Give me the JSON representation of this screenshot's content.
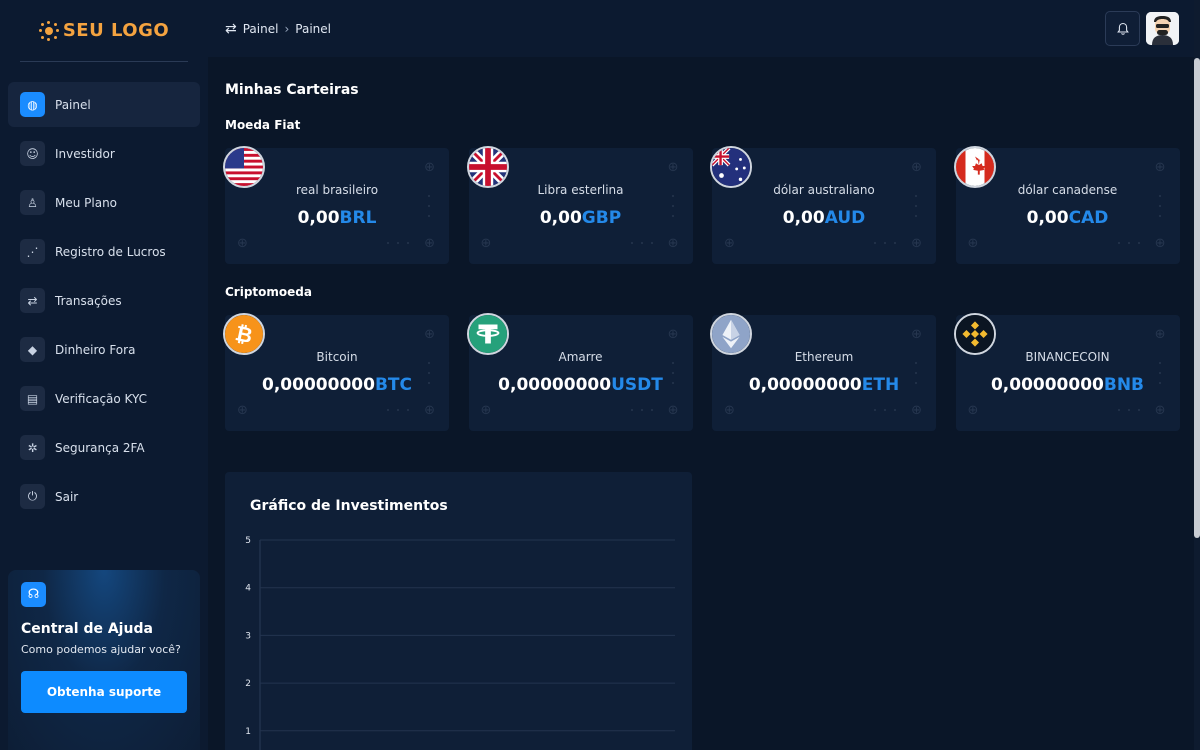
{
  "logo": {
    "text": "SEU LOGO",
    "color": "#f4a340"
  },
  "sidebar": {
    "items": [
      {
        "label": "Painel",
        "icon": "dashboard-icon",
        "glyph": "◍",
        "active": true
      },
      {
        "label": "Investidor",
        "icon": "user-icon",
        "glyph": "☺",
        "active": false
      },
      {
        "label": "Meu Plano",
        "icon": "plan-icon",
        "glyph": "♙",
        "active": false
      },
      {
        "label": "Registro de Lucros",
        "icon": "profit-chart-icon",
        "glyph": "⋰",
        "active": false
      },
      {
        "label": "Transações",
        "icon": "transfer-icon",
        "glyph": "⇄",
        "active": false
      },
      {
        "label": "Dinheiro Fora",
        "icon": "withdraw-icon",
        "glyph": "◆",
        "active": false
      },
      {
        "label": "Verificação KYC",
        "icon": "id-card-icon",
        "glyph": "▤",
        "active": false
      },
      {
        "label": "Segurança 2FA",
        "icon": "security-icon",
        "glyph": "✲",
        "active": false
      },
      {
        "label": "Sair",
        "icon": "logout-icon",
        "glyph": "⏻",
        "active": false
      }
    ],
    "help": {
      "title": "Central de Ajuda",
      "subtitle": "Como podemos ajudar você?",
      "button": "Obtenha suporte"
    }
  },
  "topbar": {
    "breadcrumb": [
      "Painel",
      "Painel"
    ]
  },
  "main": {
    "title": "Minhas Carteiras",
    "fiat_heading": "Moeda Fiat",
    "crypto_heading": "Criptomoeda",
    "fiat": [
      {
        "name": "real brasileiro",
        "amount": "0,00",
        "currency": "BRL",
        "flag": "us-flag-icon"
      },
      {
        "name": "Libra esterlina",
        "amount": "0,00",
        "currency": "GBP",
        "flag": "uk-flag-icon"
      },
      {
        "name": "dólar australiano",
        "amount": "0,00",
        "currency": "AUD",
        "flag": "au-flag-icon"
      },
      {
        "name": "dólar canadense",
        "amount": "0,00",
        "currency": "CAD",
        "flag": "ca-flag-icon"
      }
    ],
    "crypto": [
      {
        "name": "Bitcoin",
        "amount": "0,00000000",
        "currency": "BTC",
        "flag": "bitcoin-icon"
      },
      {
        "name": "Amarre",
        "amount": "0,00000000",
        "currency": "USDT",
        "flag": "tether-icon"
      },
      {
        "name": "Ethereum",
        "amount": "0,00000000",
        "currency": "ETH",
        "flag": "ethereum-icon"
      },
      {
        "name": "BINANCECOIN",
        "amount": "0,00000000",
        "currency": "BNB",
        "flag": "binance-icon"
      }
    ],
    "accent": "#2489e9"
  },
  "chart_data": {
    "type": "line",
    "title": "Gráfico de Investimentos",
    "xlabel": "",
    "ylabel": "",
    "y_ticks": [
      5,
      4,
      3,
      2,
      1
    ],
    "ylim": [
      0,
      5
    ],
    "grid": true,
    "series": []
  }
}
